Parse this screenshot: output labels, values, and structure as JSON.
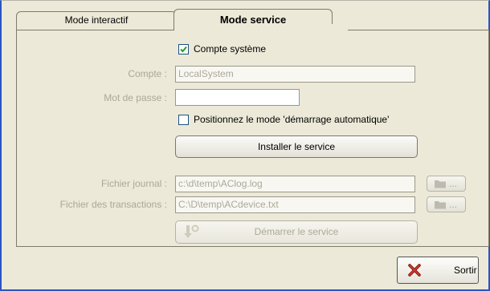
{
  "tabs": [
    {
      "label": "Mode interactif"
    },
    {
      "label": "Mode service"
    }
  ],
  "service": {
    "system_account_checkbox": {
      "label": "Compte système",
      "checked": true
    },
    "account": {
      "label": "Compte :",
      "value": "LocalSystem"
    },
    "password": {
      "label": "Mot de passe :",
      "value": ""
    },
    "autostart_checkbox": {
      "label": "Positionnez le mode 'démarrage automatique'",
      "checked": false
    },
    "install_button": "Installer le service",
    "log_file": {
      "label": "Fichier journal :",
      "value": "c:\\d\\temp\\AClog.log",
      "browse": "..."
    },
    "transactions_file": {
      "label": "Fichier des transactions :",
      "value": "C:\\D\\temp\\ACdevice.txt",
      "browse": "..."
    },
    "start_button": "Démarrer le service"
  },
  "footer": {
    "exit_button": "Sortir"
  },
  "icons": {
    "folder": "folder-icon",
    "exit": "red-x-icon",
    "start": "service-start-icon"
  },
  "colors": {
    "window_border": "#2b55c4",
    "background": "#ece9d8",
    "disabled_text": "#aca899"
  }
}
